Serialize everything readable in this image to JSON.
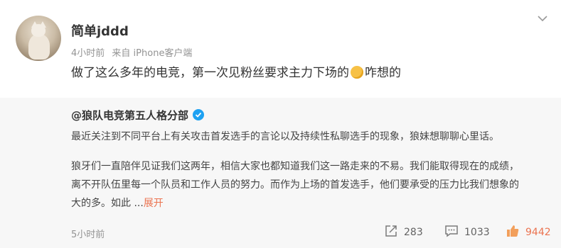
{
  "post": {
    "username": "简单jddd",
    "time": "4小时前",
    "source": "来自 iPhone客户端",
    "text_before_emoji": "做了这么多年的电竞，第一次见粉丝要求主力下场的",
    "emoji_icon": "thinking-face-emoji",
    "text_after_emoji": "咋想的"
  },
  "repost": {
    "author": "@狼队电竞第五人格分部",
    "para1": "最近关注到不同平台上有关攻击首发选手的言论以及持续性私聊选手的现象，狼妹想聊聊心里话。",
    "para2_line1": "狼牙们一直陪伴见证我们这两年，相信大家也都知道我们这一路走来的不易。我们能取得现在的成绩，",
    "para2_line2": "离不开队伍里每一个队员和工作人员的努力。而作为上场的首发选手，他们要承受的压力比我们想象的",
    "para2_line3": "大的多。如此",
    "ellipsis": "...",
    "expand_label": "展开",
    "time": "5小时前",
    "repost_count": "283",
    "comment_count": "1033",
    "like_count": "9442"
  },
  "colors": {
    "accent": "#eb7350",
    "meta_gray": "#939393",
    "repost_bg": "#f7f7f7",
    "verify_blue": "#1da1f2"
  }
}
